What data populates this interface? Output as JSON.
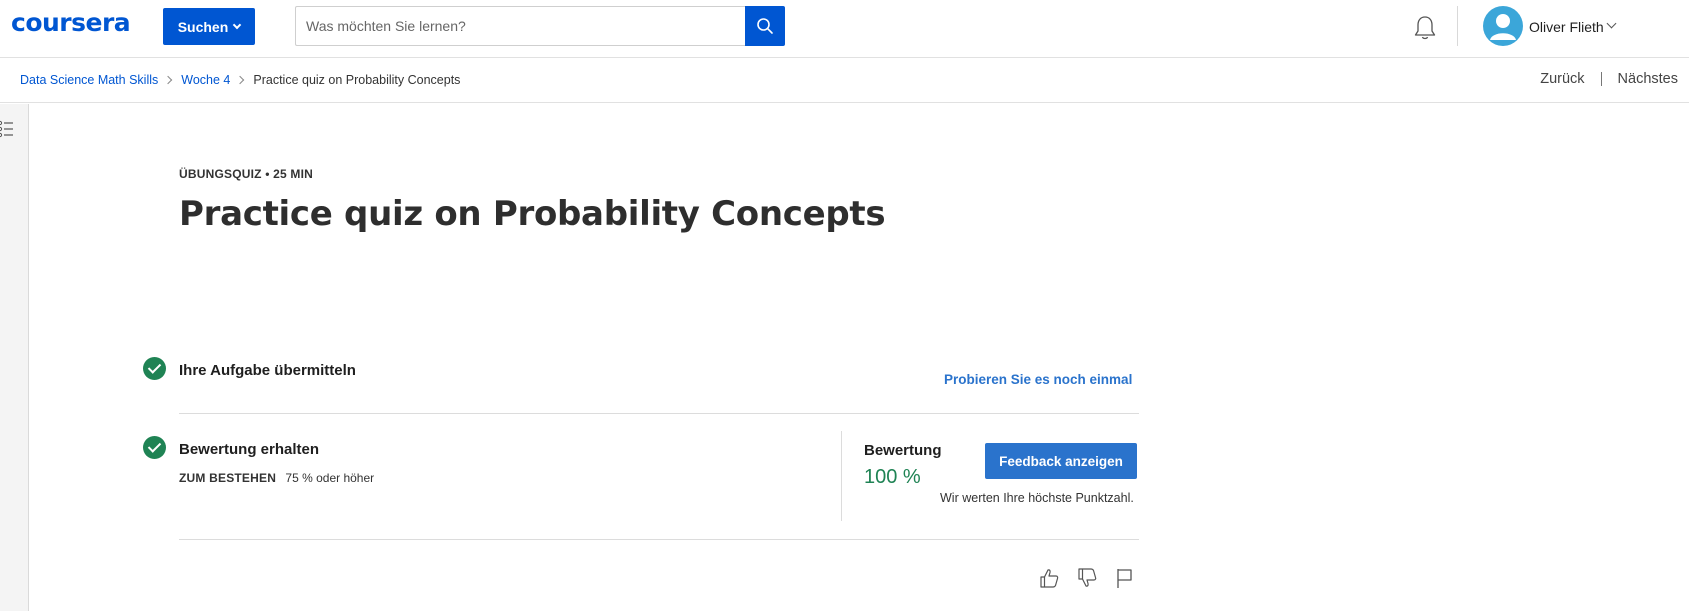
{
  "header": {
    "logo": "coursera",
    "search_button_label": "Suchen",
    "search_placeholder": "Was möchten Sie lernen?",
    "user_name": "Oliver Flieth"
  },
  "breadcrumb": {
    "items": [
      "Data Science Math Skills",
      "Woche 4"
    ],
    "current": "Practice quiz on Probability Concepts"
  },
  "nav": {
    "back_label": "Zurück",
    "next_label": "Nächstes"
  },
  "main": {
    "kicker": "ÜBUNGSQUIZ • 25 MIN",
    "title": "Practice quiz on Probability Concepts",
    "steps": {
      "submit": {
        "title": "Ihre Aufgabe übermitteln",
        "action": "Probieren Sie es noch einmal"
      },
      "grade": {
        "title": "Bewertung erhalten",
        "pass_label": "ZUM BESTEHEN",
        "pass_value": "75 % oder höher",
        "grade_label": "Bewertung",
        "grade_value": "100 %",
        "feedback_button": "Feedback anzeigen",
        "note": "Wir werten Ihre höchste Punktzahl."
      }
    }
  },
  "colors": {
    "brand": "#0056d2",
    "accent_button": "#2a73cc",
    "success": "#1f8354"
  },
  "icons": [
    "search-icon",
    "bell-icon",
    "avatar-icon",
    "menu-list-icon",
    "check-icon",
    "thumbs-up-icon",
    "thumbs-down-icon",
    "flag-icon"
  ]
}
